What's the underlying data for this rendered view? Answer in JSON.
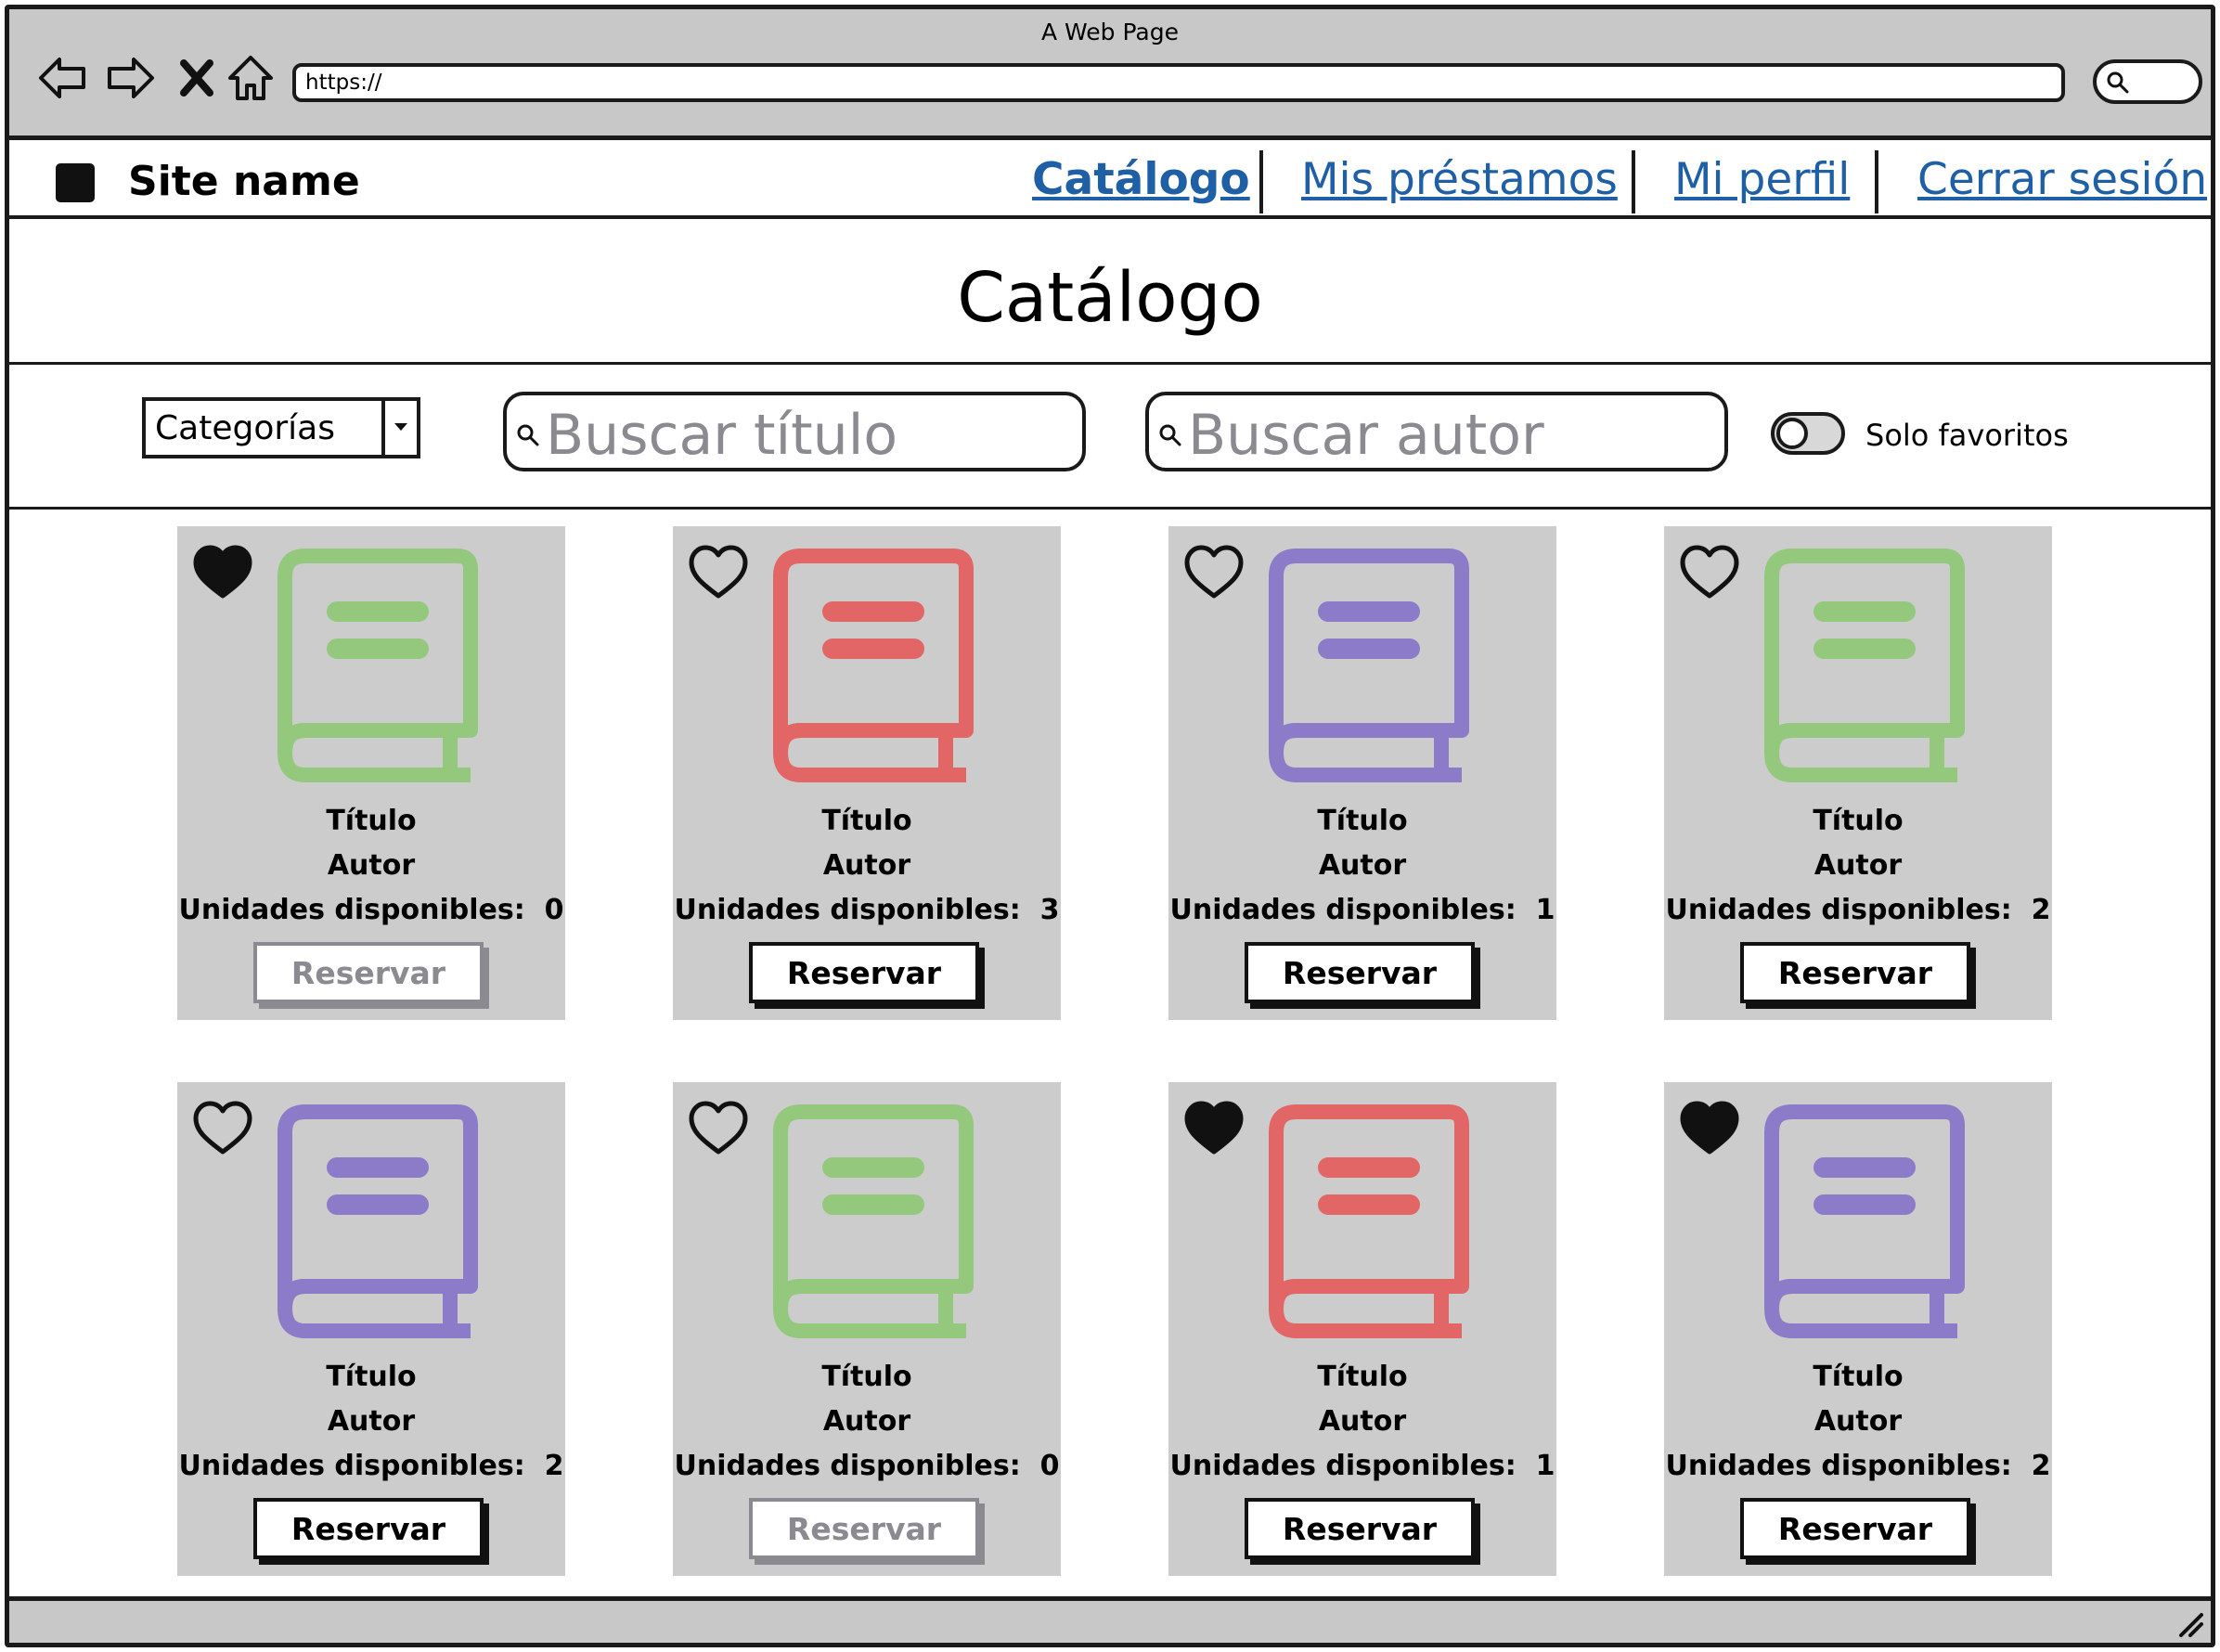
{
  "window": {
    "title": "A Web Page",
    "url": "https://"
  },
  "header": {
    "site_name": "Site name",
    "nav": [
      {
        "label": "Catálogo",
        "active": true
      },
      {
        "label": "Mis préstamos",
        "active": false
      },
      {
        "label": "Mi perfil",
        "active": false
      },
      {
        "label": "Cerrar sesión",
        "active": false
      }
    ]
  },
  "page": {
    "title": "Catálogo"
  },
  "filters": {
    "category_label": "Categorías",
    "title_search_placeholder": "Buscar título",
    "author_search_placeholder": "Buscar autor",
    "favorites_toggle_label": "Solo favoritos",
    "favorites_only": false
  },
  "colors": {
    "green": "#93c87d",
    "red": "#e26666",
    "purple": "#8b7bc8",
    "link": "#1f5fa6",
    "card_bg": "#cccccc",
    "disabled": "#8a8a90"
  },
  "books": [
    {
      "title": "Título",
      "author": "Autor",
      "units_label": "Unidades disponibles:",
      "units": "0",
      "favorite": true,
      "color": "#93c87d",
      "reserve_label": "Reservar",
      "reserve_enabled": false
    },
    {
      "title": "Título",
      "author": "Autor",
      "units_label": "Unidades disponibles:",
      "units": "3",
      "favorite": false,
      "color": "#e26666",
      "reserve_label": "Reservar",
      "reserve_enabled": true
    },
    {
      "title": "Título",
      "author": "Autor",
      "units_label": "Unidades disponibles:",
      "units": "1",
      "favorite": false,
      "color": "#8b7bc8",
      "reserve_label": "Reservar",
      "reserve_enabled": true
    },
    {
      "title": "Título",
      "author": "Autor",
      "units_label": "Unidades disponibles:",
      "units": "2",
      "favorite": false,
      "color": "#93c87d",
      "reserve_label": "Reservar",
      "reserve_enabled": true
    },
    {
      "title": "Título",
      "author": "Autor",
      "units_label": "Unidades disponibles:",
      "units": "2",
      "favorite": false,
      "color": "#8b7bc8",
      "reserve_label": "Reservar",
      "reserve_enabled": true
    },
    {
      "title": "Título",
      "author": "Autor",
      "units_label": "Unidades disponibles:",
      "units": "0",
      "favorite": false,
      "color": "#93c87d",
      "reserve_label": "Reservar",
      "reserve_enabled": false
    },
    {
      "title": "Título",
      "author": "Autor",
      "units_label": "Unidades disponibles:",
      "units": "1",
      "favorite": true,
      "color": "#e26666",
      "reserve_label": "Reservar",
      "reserve_enabled": true
    },
    {
      "title": "Título",
      "author": "Autor",
      "units_label": "Unidades disponibles:",
      "units": "2",
      "favorite": true,
      "color": "#8b7bc8",
      "reserve_label": "Reservar",
      "reserve_enabled": true
    }
  ]
}
